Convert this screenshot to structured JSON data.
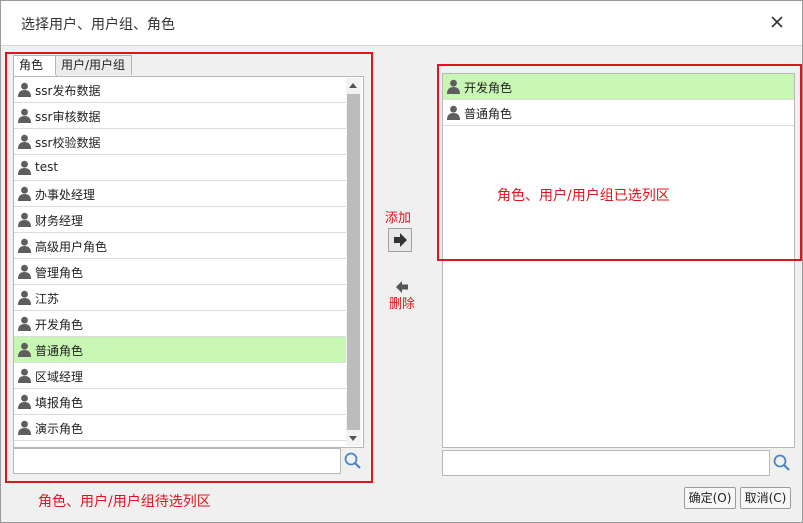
{
  "dialog": {
    "title": "选择用户、用户组、角色"
  },
  "left": {
    "tabs": [
      {
        "label": "角色"
      },
      {
        "label": "用户/用户组"
      }
    ],
    "items": [
      {
        "label": "ssr发布数据"
      },
      {
        "label": "ssr审核数据"
      },
      {
        "label": "ssr校验数据"
      },
      {
        "label": "test"
      },
      {
        "label": "办事处经理"
      },
      {
        "label": "财务经理"
      },
      {
        "label": "高级用户角色"
      },
      {
        "label": "管理角色"
      },
      {
        "label": "江苏"
      },
      {
        "label": "开发角色"
      },
      {
        "label": "普通角色",
        "selected": true
      },
      {
        "label": "区域经理"
      },
      {
        "label": "填报角色"
      },
      {
        "label": "演示角色"
      }
    ],
    "search_value": "",
    "annotation": "角色、用户/用户组待选列区"
  },
  "middle": {
    "add_label": "添加",
    "remove_label": "删除"
  },
  "right": {
    "items": [
      {
        "label": "开发角色",
        "selected": true
      },
      {
        "label": "普通角色"
      }
    ],
    "search_value": "",
    "annotation": "角色、用户/用户组已选列区"
  },
  "buttons": {
    "ok": "确定(O)",
    "cancel": "取消(C)"
  },
  "colors": {
    "selected_row": "#c8f7b4",
    "annotation_red": "#e0141e"
  },
  "icons": {
    "close": "close-icon",
    "user": "user-icon",
    "search": "search-icon",
    "add": "arrow-right-icon",
    "remove": "arrow-left-icon"
  }
}
